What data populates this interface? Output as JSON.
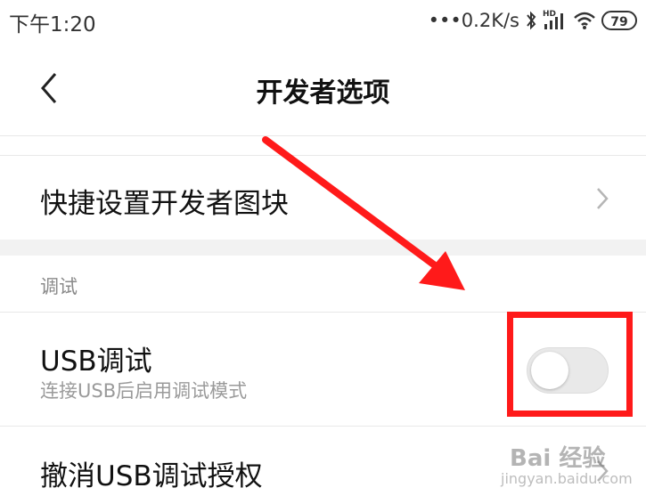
{
  "status_bar": {
    "time": "下午1:20",
    "network_speed": "•••0.2K/s",
    "hd_label": "HD",
    "battery": "79",
    "icons": [
      "bluetooth-icon",
      "signal-icon",
      "wifi-icon",
      "battery-icon"
    ]
  },
  "header": {
    "title": "开发者选项",
    "back_icon": "chevron-left-icon"
  },
  "rows": {
    "quick_tiles": {
      "title": "快捷设置开发者图块"
    },
    "debug_section": {
      "label": "调试"
    },
    "usb_debugging": {
      "title": "USB调试",
      "subtitle": "连接USB后启用调试模式",
      "enabled": false
    },
    "revoke_usb": {
      "title": "撤消USB调试授权"
    }
  },
  "watermark": {
    "brand": "Bai 经验",
    "url": "jingyan.baidu.com"
  },
  "colors": {
    "annotation": "#ff1a1a",
    "toggle_off": "#e9e9e9",
    "section_gap": "#f2f2f2"
  }
}
